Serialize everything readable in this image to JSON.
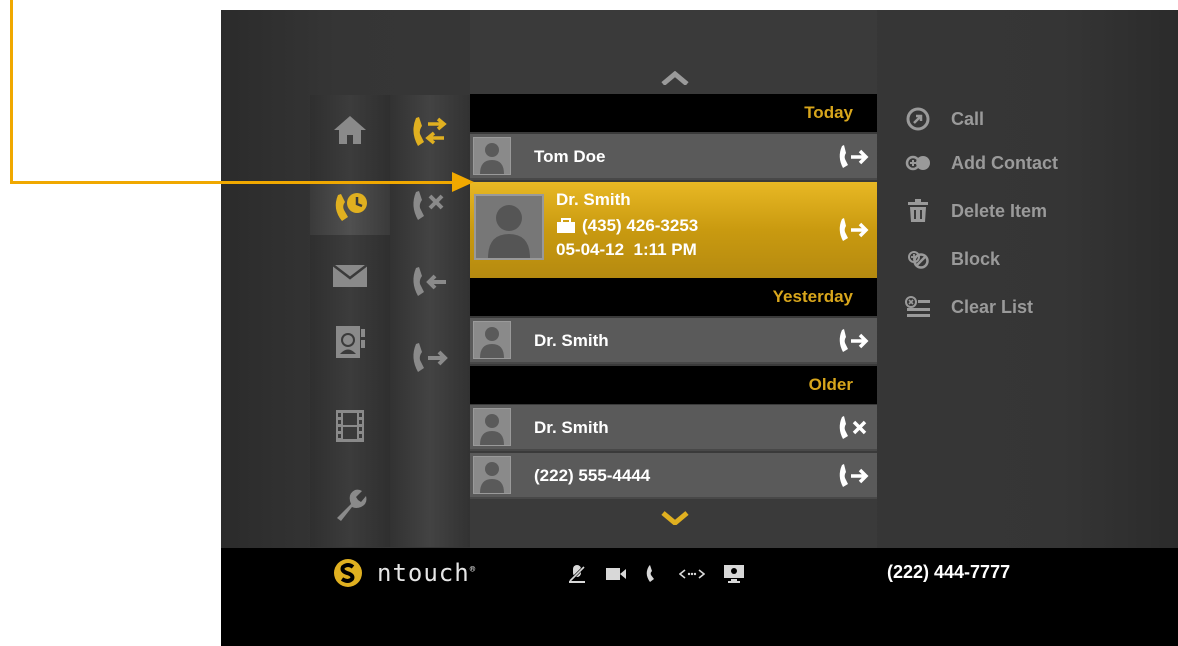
{
  "colors": {
    "accent": "#d8a61c",
    "annotation": "#f0a800",
    "panel": "#3a3a3a",
    "active_row": "#e0b020"
  },
  "nav": {
    "items": [
      {
        "icon": "home-icon"
      },
      {
        "icon": "call-history-icon",
        "selected": true
      },
      {
        "icon": "mail-icon"
      },
      {
        "icon": "contacts-book-icon"
      },
      {
        "icon": "film-icon"
      },
      {
        "icon": "wrench-icon"
      }
    ]
  },
  "filters": {
    "items": [
      {
        "icon": "all-calls-icon",
        "selected": true
      },
      {
        "icon": "missed-calls-icon"
      },
      {
        "icon": "incoming-calls-icon"
      },
      {
        "icon": "outgoing-calls-icon"
      }
    ]
  },
  "list": {
    "sections": {
      "today": "Today",
      "yesterday": "Yesterday",
      "older": "Older"
    },
    "rows": [
      {
        "name": "Tom Doe",
        "direction": "outgoing"
      },
      {
        "name": "Dr. Smith",
        "phone": "(435) 426-3253",
        "datetime": "05-04-12  1:11 PM",
        "direction": "outgoing",
        "active": true
      },
      {
        "name": "Dr. Smith",
        "direction": "outgoing"
      },
      {
        "name": "Dr. Smith",
        "direction": "missed"
      },
      {
        "name": "(222) 555-4444",
        "direction": "outgoing"
      }
    ]
  },
  "actions": {
    "call": "Call",
    "add_contact": "Add Contact",
    "delete_item": "Delete Item",
    "block": "Block",
    "clear_list": "Clear List"
  },
  "statusbar": {
    "brand": "ntouch",
    "brand_mark": "®",
    "own_number": "(222) 444-7777",
    "icons": [
      "mic-muted-icon",
      "video-camera-icon",
      "phone-icon",
      "signal-icon",
      "display-icon"
    ]
  }
}
